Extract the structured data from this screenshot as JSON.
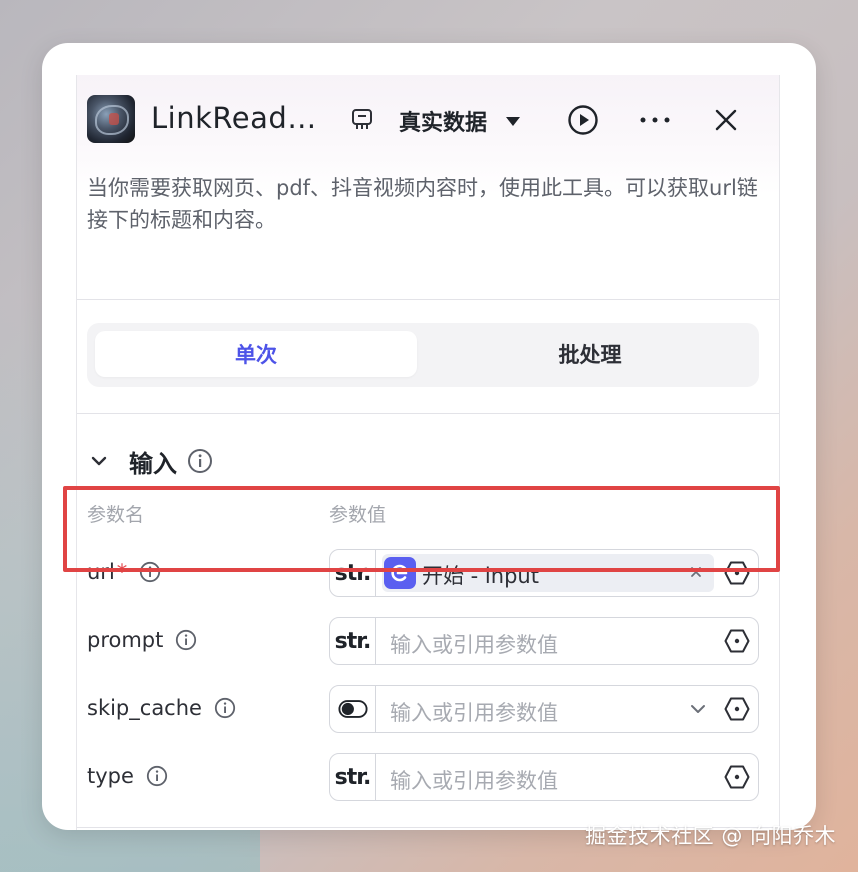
{
  "header": {
    "title": "LinkRead…",
    "dataset_label": "真实数据",
    "icons": {
      "dataset": "database-icon",
      "caret": "caret-down-icon",
      "run": "play-circle-icon",
      "more": "more-icon",
      "close": "close-icon"
    }
  },
  "description": "当你需要获取网页、pdf、抖音视频内容时，使用此工具。可以获取url链接下的标题和内容。",
  "mode_tabs": [
    {
      "label": "单次",
      "active": true
    },
    {
      "label": "批处理",
      "active": false
    }
  ],
  "inputs": {
    "title": "输入",
    "columns": {
      "name": "参数名",
      "value": "参数值"
    },
    "params": [
      {
        "name": "url",
        "required": true,
        "type_tag": "str.",
        "ref": {
          "node": "开始 - input"
        }
      },
      {
        "name": "prompt",
        "required": false,
        "type_tag": "str.",
        "placeholder": "输入或引用参数值"
      },
      {
        "name": "skip_cache",
        "required": false,
        "type_tag": "toggle",
        "placeholder": "输入或引用参数值"
      },
      {
        "name": "type",
        "required": false,
        "type_tag": "str.",
        "placeholder": "输入或引用参数值"
      }
    ]
  },
  "required_marker": "*",
  "colors": {
    "accent": "#4d53e8",
    "highlight": "#e04444",
    "required": "#e5484d"
  },
  "watermark": "掘金技术社区 @ 向阳乔木"
}
